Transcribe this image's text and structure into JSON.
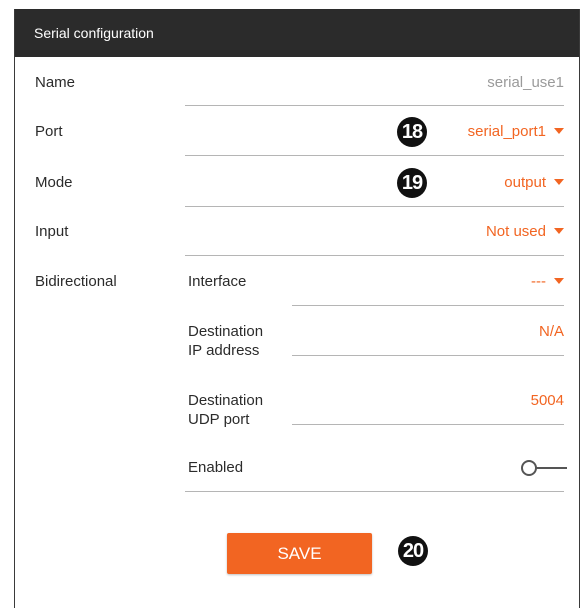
{
  "header": {
    "title": "Serial configuration"
  },
  "fields": {
    "name": {
      "label": "Name",
      "value": "serial_use1"
    },
    "port": {
      "label": "Port",
      "value": "serial_port1"
    },
    "mode": {
      "label": "Mode",
      "value": "output"
    },
    "input": {
      "label": "Input",
      "value": "Not used"
    }
  },
  "bidirectional": {
    "label": "Bidirectional",
    "interface": {
      "label": "Interface",
      "value": "---"
    },
    "destination_ip": {
      "label_line1": "Destination",
      "label_line2": "IP address",
      "value": "N/A"
    },
    "destination_udp": {
      "label_line1": "Destination",
      "label_line2": "UDP port",
      "value": "5004"
    },
    "enabled": {
      "label": "Enabled",
      "on": false
    }
  },
  "buttons": {
    "save_label": "SAVE"
  },
  "callouts": {
    "port": "18",
    "mode": "19",
    "save": "20"
  },
  "colors": {
    "accent": "#f26522",
    "header_bg": "#2b2b2b",
    "muted_value": "#9a9a9a"
  }
}
